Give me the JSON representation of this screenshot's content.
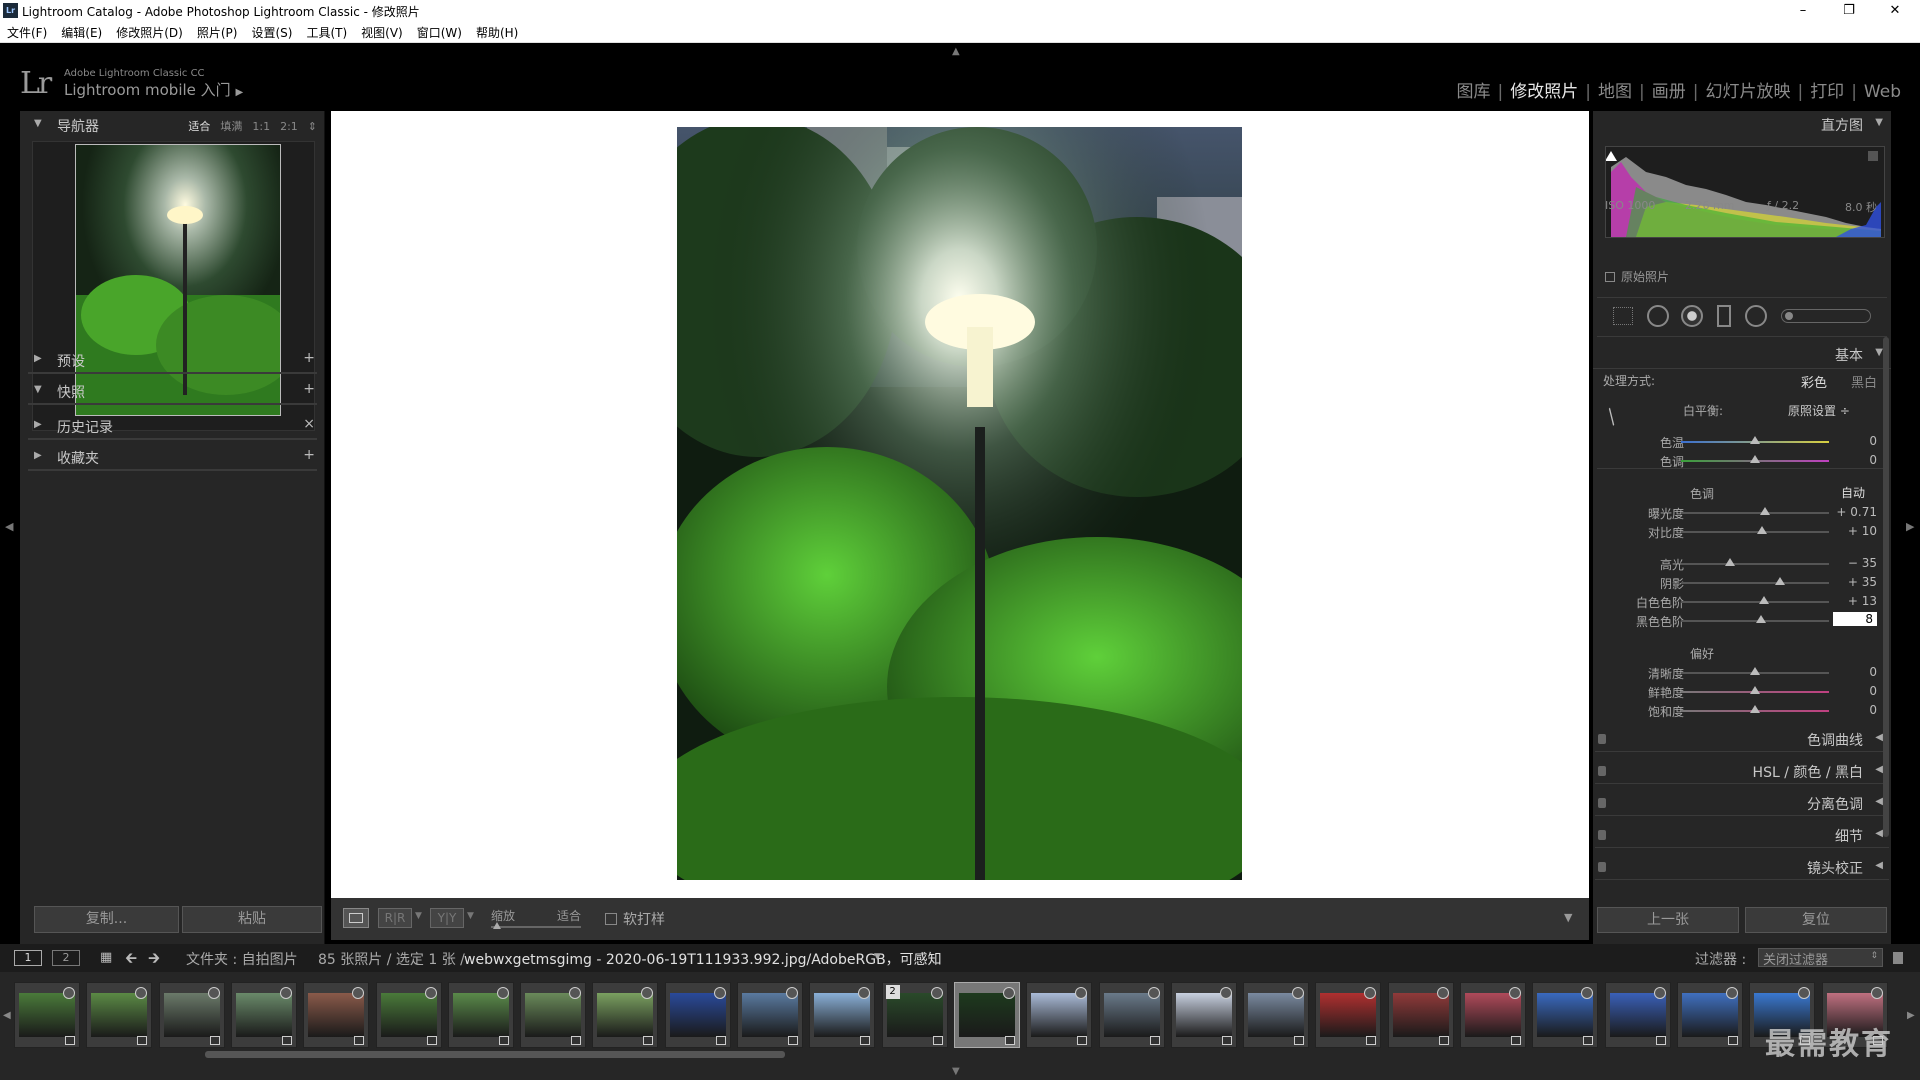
{
  "window": {
    "title": "Lightroom Catalog - Adobe Photoshop Lightroom Classic - 修改照片",
    "app_icon": "Lr",
    "controls": [
      "minimize-icon",
      "restore-icon",
      "close-icon"
    ]
  },
  "menu": [
    "文件(F)",
    "编辑(E)",
    "修改照片(D)",
    "照片(P)",
    "设置(S)",
    "工具(T)",
    "视图(V)",
    "窗口(W)",
    "帮助(H)"
  ],
  "brand": {
    "logo": "Lr",
    "line1": "Adobe Lightroom Classic CC",
    "line2": "Lightroom mobile 入门"
  },
  "modules": [
    "图库",
    "修改照片",
    "地图",
    "画册",
    "幻灯片放映",
    "打印",
    "Web"
  ],
  "active_module": "修改照片",
  "left_panel": {
    "navigator": {
      "label": "导航器",
      "options": [
        "适合",
        "填满",
        "1:1",
        "2:1"
      ],
      "active_option": "适合"
    },
    "presets": {
      "label": "预设",
      "action": "+"
    },
    "snapshots": {
      "label": "快照",
      "action": "+"
    },
    "history": {
      "label": "历史记录",
      "action": "×"
    },
    "collections": {
      "label": "收藏夹",
      "action": "+"
    },
    "copy_button": "复制...",
    "paste_button": "粘贴"
  },
  "toolbar": {
    "zoom_label": "缩放",
    "zoom_value": "适合",
    "softproof_label": "软打样"
  },
  "right_panel": {
    "histogram": {
      "label": "直方图",
      "iso": "ISO 1000",
      "focal": "2.26 mm",
      "aperture": "ƒ / 2.2",
      "shutter": "8.0 秒",
      "original_photo": "原始照片"
    },
    "basic": {
      "label": "基本",
      "treatment_label": "处理方式:",
      "treatment_options": [
        "彩色",
        "黑白"
      ],
      "wb_label": "白平衡:",
      "wb_value": "原照设置 ÷",
      "tone_label": "色调",
      "auto_label": "自动",
      "presence_label": "偏好",
      "wb_sliders": [
        {
          "name": "色温",
          "value": "0",
          "pos": 0.5
        },
        {
          "name": "色调",
          "value": "0",
          "pos": 0.5
        }
      ],
      "tone_sliders": [
        {
          "name": "曝光度",
          "value": "+ 0.71",
          "pos": 0.57
        },
        {
          "name": "对比度",
          "value": "+ 10",
          "pos": 0.55
        }
      ],
      "tone_sliders2": [
        {
          "name": "高光",
          "value": "− 35",
          "pos": 0.33
        },
        {
          "name": "阴影",
          "value": "+ 35",
          "pos": 0.67
        },
        {
          "name": "白色色阶",
          "value": "+ 13",
          "pos": 0.56
        },
        {
          "name": "黑色色阶",
          "value": "8",
          "pos": 0.54
        }
      ],
      "presence_sliders": [
        {
          "name": "清晰度",
          "value": "0",
          "pos": 0.5
        },
        {
          "name": "鲜艳度",
          "value": "0",
          "pos": 0.5
        },
        {
          "name": "饱和度",
          "value": "0",
          "pos": 0.5
        }
      ]
    },
    "sections": [
      "色调曲线",
      "HSL / 颜色 / 黑白",
      "分离色调",
      "细节",
      "镜头校正"
    ],
    "prev_button": "上一张",
    "reset_button": "复位"
  },
  "filmstrip_bar": {
    "page1": "1",
    "page2": "2",
    "path": "文件夹 : 自拍图片",
    "count": "85 张照片 / 选定 1 张 /",
    "filename": "webwxgetmsgimg - 2020-06-19T111933.992.jpg/AdobeRGB，可感知",
    "filter_label": "过滤器 :",
    "filter_value": "关闭过滤器"
  },
  "filmstrip": {
    "selected_index": 13,
    "stack_badge": "2",
    "thumb_colors": [
      "#4a7a3a",
      "#5b8a45",
      "#6b7a6a",
      "#6a8a6a",
      "#8a5a4a",
      "#4a7a3a",
      "#5a8a4a",
      "#6a8a5a",
      "#7aa060",
      "#2a4a9a",
      "#5a7aa0",
      "#8ab0d8",
      "#2a4a2a",
      "#1e3a1e",
      "#aabbd8",
      "#6a7a8a",
      "#c8d0e0",
      "#7a8aa0",
      "#b03030",
      "#903a3a",
      "#b04a5a",
      "#3a6ac0",
      "#3a60b8",
      "#4070c0",
      "#3a78d0",
      "#c07080"
    ]
  },
  "watermark": "最需教育"
}
